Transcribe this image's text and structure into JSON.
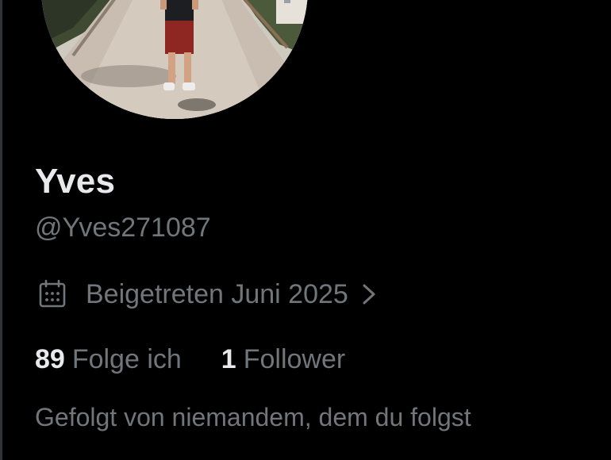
{
  "profile": {
    "display_name": "Yves",
    "handle": "@Yves271087",
    "joined": "Beigetreten Juni 2025",
    "following_count": "89",
    "following_label": "Folge ich",
    "followers_count": "1",
    "followers_label": "Follower",
    "followed_by": "Gefolgt von niemandem, dem du folgst"
  },
  "icons": {
    "joined": "calendar-icon",
    "joined_arrow": "chevron-right-icon"
  },
  "colors": {
    "background": "#000000",
    "primary_text": "#e7e9ea",
    "secondary_text": "#71767b"
  }
}
